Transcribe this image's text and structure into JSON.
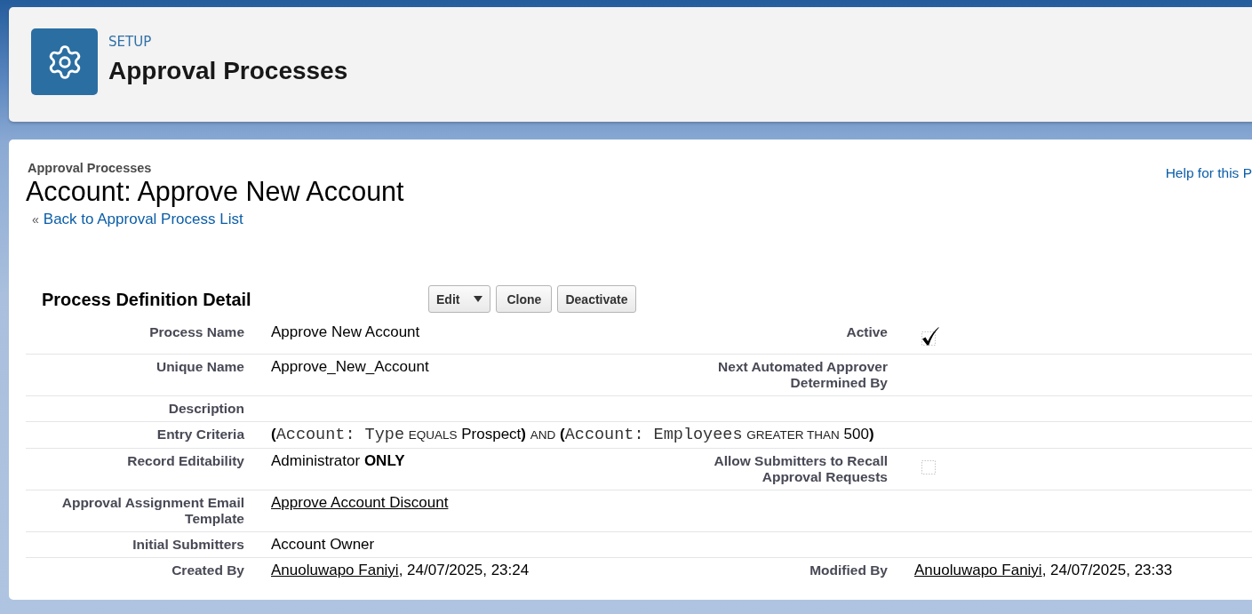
{
  "header": {
    "eyebrow": "SETUP",
    "title": "Approval Processes"
  },
  "page": {
    "breadcrumb": "Approval Processes",
    "title": "Account: Approve New Account",
    "back_link": {
      "marker": "«",
      "label": "Back to Approval Process List"
    },
    "help_link": "Help for this P"
  },
  "detail": {
    "title": "Process Definition Detail",
    "buttons": [
      {
        "label": "Edit",
        "menu": true
      },
      {
        "label": "Clone",
        "menu": false
      },
      {
        "label": "Deactivate",
        "menu": false
      }
    ],
    "rows": [
      {
        "cells": [
          {
            "label": "Process Name",
            "kind": "text",
            "value": "Approve New Account"
          },
          {
            "label": "Active",
            "kind": "checkbox",
            "checked": true
          }
        ]
      },
      {
        "cells": [
          {
            "label": "Unique Name",
            "kind": "text",
            "value": "Approve_New_Account"
          },
          {
            "label": "Next Automated Approver Determined By"
          }
        ]
      },
      {
        "cells": [
          {
            "label": "Description"
          }
        ]
      },
      {
        "cells": [
          {
            "label": "Entry Criteria",
            "kind": "criteria",
            "parts": [
              {
                "kind": "open",
                "text": "("
              },
              {
                "kind": "field",
                "text": "Account: Type"
              },
              {
                "kind": "operator",
                "text": "EQUALS"
              },
              {
                "kind": "value",
                "text": "Prospect"
              },
              {
                "kind": "close",
                "text": ")"
              },
              {
                "kind": "conjunction",
                "text": "AND"
              },
              {
                "kind": "open",
                "text": "("
              },
              {
                "kind": "field",
                "text": "Account: Employees"
              },
              {
                "kind": "operator",
                "text": "GREATER THAN"
              },
              {
                "kind": "value",
                "text": "500"
              },
              {
                "kind": "close",
                "text": ")"
              }
            ]
          }
        ]
      },
      {
        "cells": [
          {
            "label": "Record Editability",
            "kind": "rich",
            "value": "Administrator **ONLY**"
          },
          {
            "label": "Allow Submitters to Recall Approval Requests",
            "kind": "checkbox",
            "checked": false
          }
        ]
      },
      {
        "cells": [
          {
            "label": "Approval Assignment Email Template",
            "kind": "link",
            "value": "Approve Account Discount"
          }
        ]
      },
      {
        "cells": [
          {
            "label": "Initial Submitters",
            "kind": "text",
            "value": "Account Owner"
          }
        ]
      },
      {
        "cells": [
          {
            "label": "Created By",
            "kind": "user",
            "user": "Anuoluwapo Faniyi",
            "timestamp": ", 24/07/2025, 23:24"
          },
          {
            "label": "Modified By",
            "kind": "user",
            "user": "Anuoluwapo Faniyi",
            "timestamp": ", 24/07/2025, 23:33"
          }
        ]
      }
    ]
  }
}
